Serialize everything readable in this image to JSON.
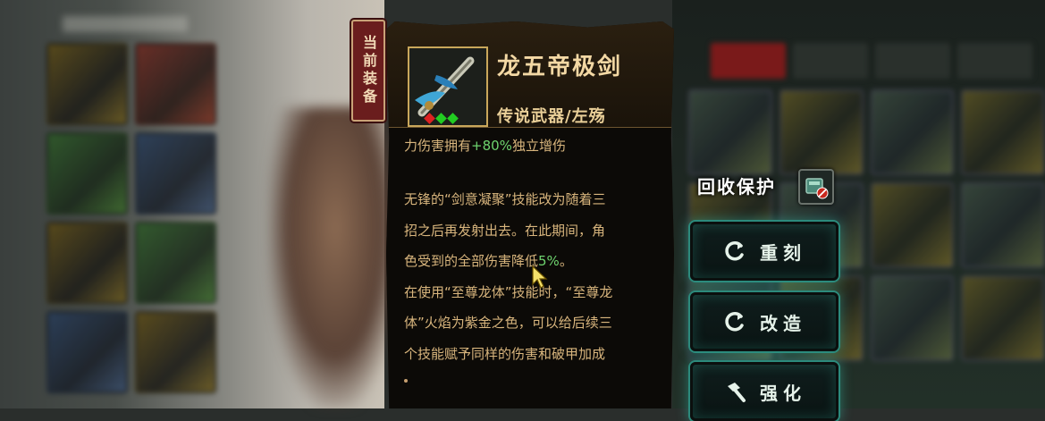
{
  "current_tag": "当前装备",
  "item": {
    "name": "龙五帝极剑",
    "type": "传说武器/左殇",
    "gems": [
      "red",
      "green",
      "green"
    ]
  },
  "description": {
    "line0_prefix": "力伤害拥有",
    "line0_highlight": "+80%",
    "line0_suffix": "独立增伤",
    "lines": [
      "无锋的“剑意凝聚”技能改为随着三",
      "招之后再发射出去。在此期间，角",
      "色受到的全部伤害降低5%。",
      "在使用“至尊龙体”技能时，“至尊龙",
      "体”火焰为紫金之色，可以给后续三",
      "个技能赋予同样的伤害和破甲加成"
    ]
  },
  "recycle_protect": {
    "label": "回收保护"
  },
  "actions": [
    {
      "label": "重刻",
      "icon": "refresh-icon"
    },
    {
      "label": "改造",
      "icon": "refresh-icon"
    },
    {
      "label": "强化",
      "icon": "hammer-icon"
    }
  ],
  "colors": {
    "name": "#f3d8a4",
    "desc": "#d8b57d",
    "highlight": "#6ed36e",
    "button_glow": "#2c8a7c"
  }
}
